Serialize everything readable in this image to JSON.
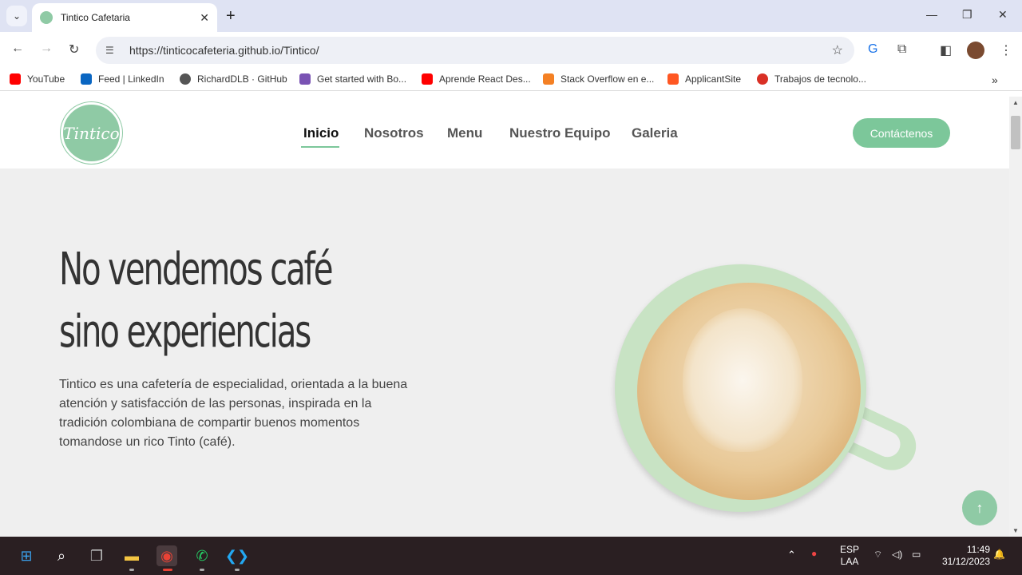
{
  "browser": {
    "tab_title": "Tintico Cafetaria",
    "url": "https://tinticocafeteria.github.io/Tintico/",
    "bookmarks": [
      {
        "label": "YouTube",
        "color": "#ff0000"
      },
      {
        "label": "Feed | LinkedIn",
        "color": "#0a66c2"
      },
      {
        "label": "RichardDLB · GitHub",
        "color": "#555555"
      },
      {
        "label": "Get started with Bo...",
        "color": "#7952b3"
      },
      {
        "label": "Aprende React Des...",
        "color": "#ff0000"
      },
      {
        "label": "Stack Overflow en e...",
        "color": "#f48024"
      },
      {
        "label": "ApplicantSite",
        "color": "#ff5722"
      },
      {
        "label": "Trabajos de tecnolo...",
        "color": "#d93025"
      }
    ]
  },
  "site": {
    "logo_text": "Tintico",
    "nav": [
      "Inicio",
      "Nosotros",
      "Menu",
      "Nuestro Equipo",
      "Galeria"
    ],
    "contact": "Contáctenos",
    "hero_title_1": "No vendemos café",
    "hero_title_2": "sino experiencias",
    "hero_text": "Tintico es una cafetería de especialidad, orientada a la buena atención y satisfacción de las personas, inspirada en la tradición colombiana de compartir buenos momentos tomandose un rico Tinto (café).",
    "accent": "#7cc79a"
  },
  "taskbar": {
    "lang_1": "ESP",
    "lang_2": "LAA",
    "time": "11:49",
    "date": "31/12/2023"
  }
}
